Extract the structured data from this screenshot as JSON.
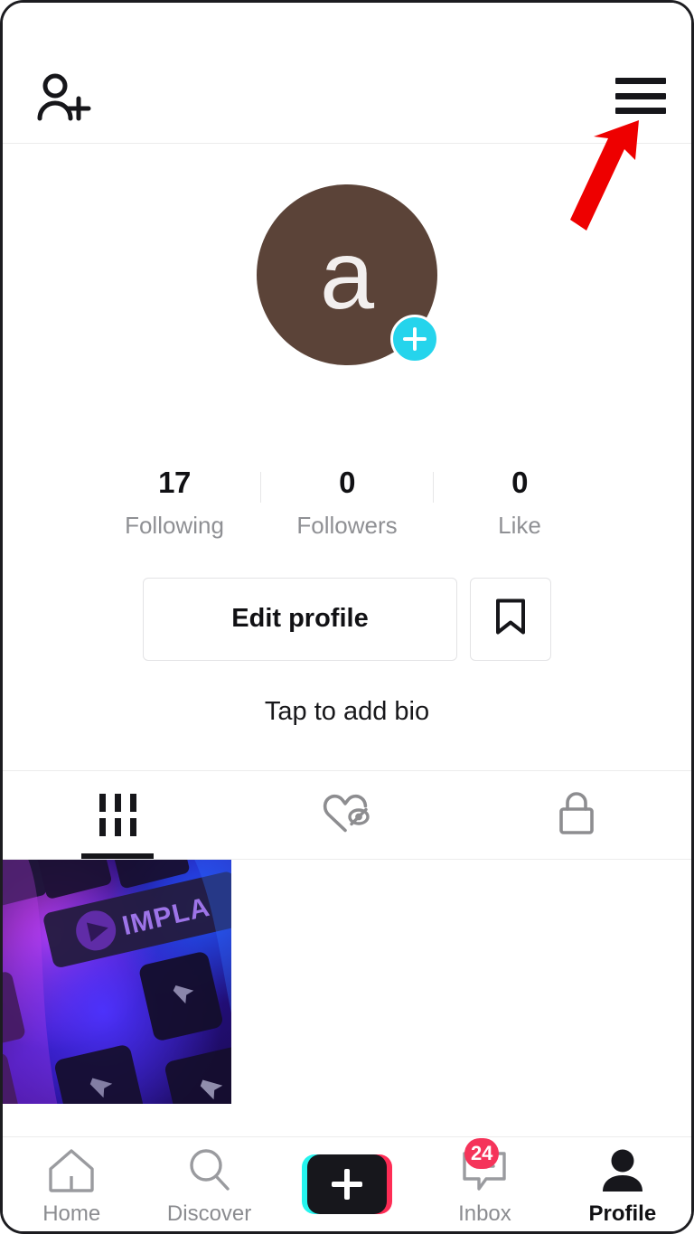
{
  "app": {
    "name": "TikTok",
    "screen": "Profile"
  },
  "colors": {
    "avatar_bg": "#5b4338",
    "avatar_plus": "#25d4ec",
    "accent_cyan": "#25f4ee",
    "accent_pink": "#fe2c55",
    "badge_red": "#f5345a",
    "text_primary": "#111114",
    "text_muted": "#8f9094",
    "annotation_arrow": "#ee0000"
  },
  "topbar": {
    "add_friend_icon": "person-plus-icon",
    "menu_icon": "hamburger-menu-icon"
  },
  "profile": {
    "avatar_letter": "a",
    "avatar_add_icon": "plus-icon",
    "stats": [
      {
        "value": "17",
        "label": "Following"
      },
      {
        "value": "0",
        "label": "Followers"
      },
      {
        "value": "0",
        "label": "Like"
      }
    ],
    "edit_button_label": "Edit profile",
    "bookmark_icon": "bookmark-icon",
    "bio_placeholder": "Tap to add bio"
  },
  "tabs": [
    {
      "icon": "grid-icon",
      "name": "videos",
      "active": true
    },
    {
      "icon": "heart-slash-icon",
      "name": "liked",
      "active": false
    },
    {
      "icon": "lock-icon",
      "name": "private",
      "active": false
    }
  ],
  "videos": [
    {
      "description": "RGB backlit keyboard keycaps lit purple and blue with IMPLA text"
    }
  ],
  "bottom_nav": [
    {
      "label": "Home",
      "icon": "home-icon",
      "active": false,
      "badge": null
    },
    {
      "label": "Discover",
      "icon": "search-icon",
      "active": false,
      "badge": null
    },
    {
      "label": "",
      "icon": "create-plus-icon",
      "active": false,
      "badge": null
    },
    {
      "label": "Inbox",
      "icon": "message-icon",
      "active": false,
      "badge": "24"
    },
    {
      "label": "Profile",
      "icon": "person-icon",
      "active": true,
      "badge": null
    }
  ],
  "annotation": {
    "type": "arrow",
    "points_to": "hamburger-menu-icon"
  }
}
